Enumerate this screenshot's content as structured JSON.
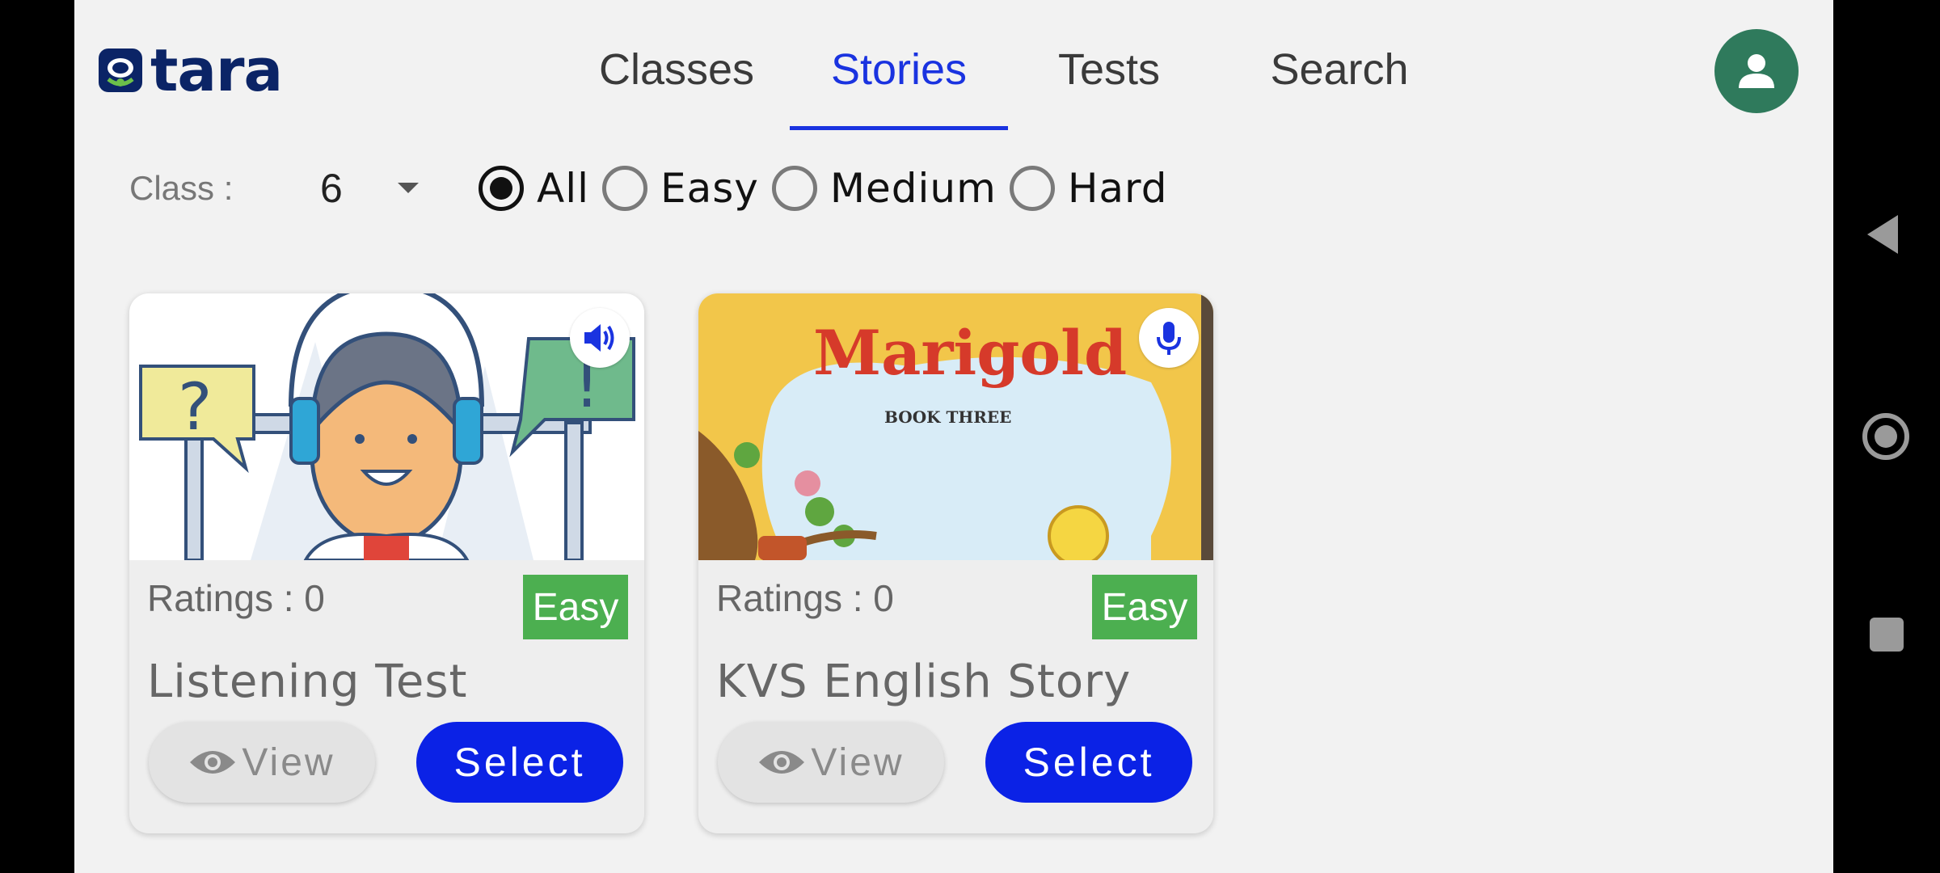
{
  "header": {
    "logo_text": "tara",
    "tabs": [
      {
        "label": "Classes",
        "active": false
      },
      {
        "label": "Stories",
        "active": true
      },
      {
        "label": "Tests",
        "active": false
      },
      {
        "label": "Search",
        "active": false
      }
    ],
    "avatar_icon": "user-icon"
  },
  "filters": {
    "class_label": "Class :",
    "class_value": "6",
    "difficulty_options": [
      {
        "label": "All",
        "checked": true
      },
      {
        "label": "Easy",
        "checked": false
      },
      {
        "label": "Medium",
        "checked": false
      },
      {
        "label": "Hard",
        "checked": false
      }
    ]
  },
  "cards": [
    {
      "title": "Listening Test",
      "ratings": "Ratings : 0",
      "level": "Easy",
      "media_icon": "speaker-icon",
      "view_label": "View",
      "select_label": "Select"
    },
    {
      "title": "KVS English Story",
      "ratings": "Ratings : 0",
      "level": "Easy",
      "media_icon": "microphone-icon",
      "view_label": "View",
      "select_label": "Select",
      "cover_title": "Marigold",
      "cover_subtitle": "BOOK THREE"
    }
  ],
  "colors": {
    "accent": "#1a33e0",
    "select_button": "#0b22e6",
    "badge_green": "#4caf50",
    "avatar": "#2f7a5c",
    "logo": "#0b2466"
  }
}
